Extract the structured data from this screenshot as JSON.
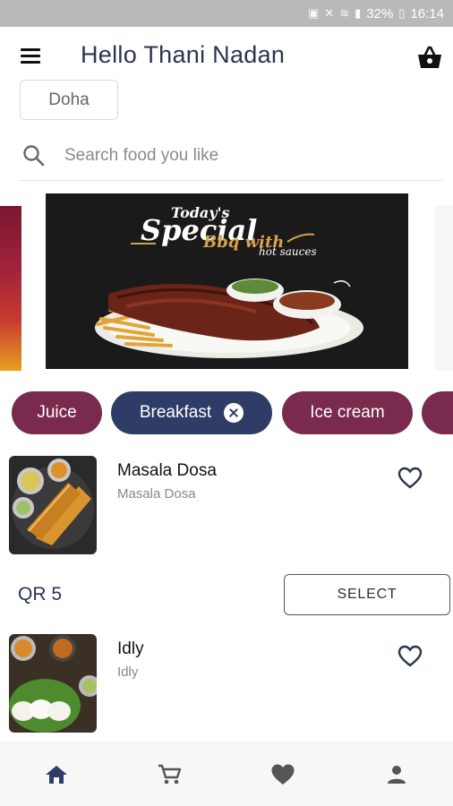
{
  "status_bar": {
    "battery": "32%",
    "time": "16:14"
  },
  "app_bar": {
    "greeting": "Hello Thani Nadan"
  },
  "location": {
    "label": "Doha"
  },
  "search": {
    "placeholder": "Search food you like"
  },
  "banner": {
    "line1": "Today's",
    "line2": "Special",
    "line3": "Bbq with",
    "line4": "hot sauces"
  },
  "categories": [
    {
      "label": "Juice",
      "selected": false
    },
    {
      "label": "Breakfast",
      "selected": true
    },
    {
      "label": "Ice cream",
      "selected": false
    }
  ],
  "products": [
    {
      "name": "Masala Dosa",
      "description": "Masala Dosa",
      "price": "QR 5",
      "action": "SELECT"
    },
    {
      "name": "Idly",
      "description": "Idly"
    }
  ],
  "icons": {
    "menu": "menu-icon",
    "basket": "basket-icon",
    "search": "search-icon",
    "favorite": "heart-outline-icon",
    "nav": [
      "home-icon",
      "cart-icon",
      "heart-icon",
      "person-icon"
    ]
  },
  "colors": {
    "primary": "#2f3d66",
    "chip_maroon": "#7a2a4d",
    "title_text": "#2b3550",
    "status_bar": "#b9b9b9",
    "nav_background": "#f7f7f7"
  }
}
